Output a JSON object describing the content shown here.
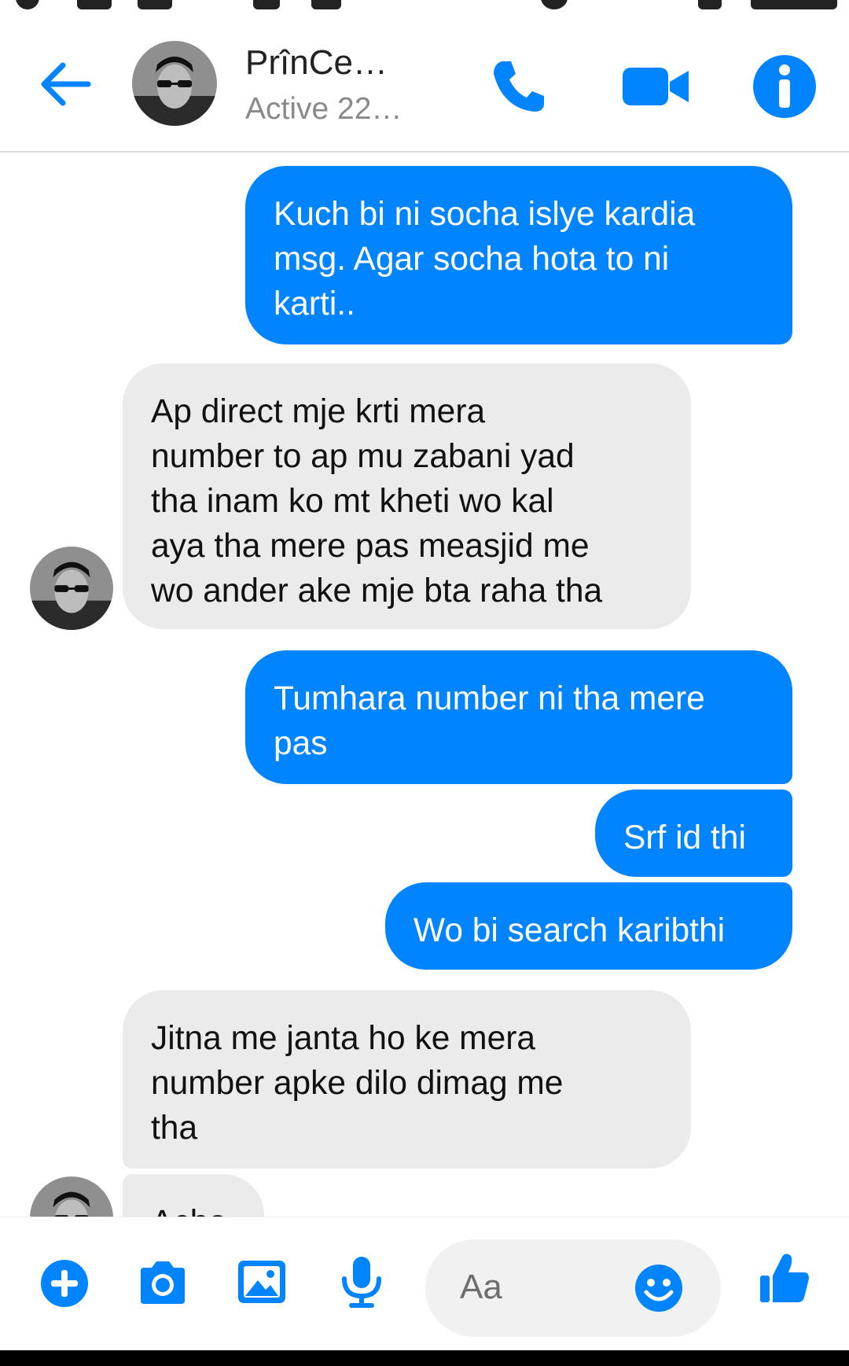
{
  "header": {
    "contact_name": "PrînCe…",
    "contact_status": "Active 22…"
  },
  "messages": [
    {
      "side": "sent",
      "text": "Kuch bi ni socha islye kardia\nmsg. Agar socha hota to ni\nkarti.."
    },
    {
      "side": "received",
      "text": "Ap direct mje krti mera\nnumber to ap mu zabani yad\ntha inam ko mt kheti wo kal\naya tha mere pas measjid me\nwo ander ake mje bta raha tha"
    },
    {
      "side": "sent",
      "text": "Tumhara number ni tha mere\npas"
    },
    {
      "side": "sent",
      "text": "Srf id thi"
    },
    {
      "side": "sent",
      "text": "Wo bi search karibthi"
    },
    {
      "side": "received",
      "text": "Jitna me janta ho ke mera\nnumber apke dilo dimag me\ntha"
    },
    {
      "side": "received",
      "text": "Acha"
    }
  ],
  "composer": {
    "placeholder": "Aa"
  },
  "colors": {
    "accent": "#0084ff",
    "received_bubble": "#ebebeb"
  },
  "icons": [
    "back-arrow-icon",
    "phone-icon",
    "video-camera-icon",
    "info-icon",
    "plus-icon",
    "camera-icon",
    "image-icon",
    "microphone-icon",
    "emoji-icon",
    "thumbs-up-icon"
  ]
}
